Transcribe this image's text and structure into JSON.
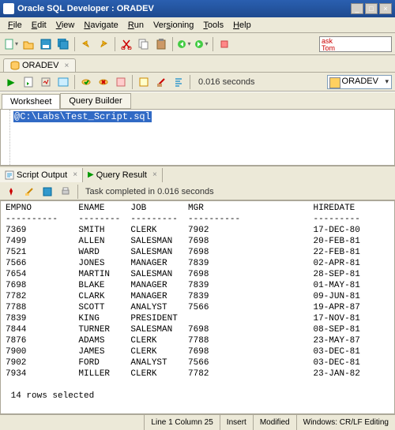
{
  "window": {
    "title": "Oracle SQL Developer : ORADEV"
  },
  "menu": {
    "file": "File",
    "edit": "Edit",
    "view": "View",
    "navigate": "Navigate",
    "run": "Run",
    "versioning": "Versioning",
    "tools": "Tools",
    "help": "Help"
  },
  "ask": {
    "line1": "ask",
    "line2": "Tom"
  },
  "connTab": {
    "label": "ORADEV"
  },
  "sqlTiming": "0.016 seconds",
  "connSelect": "ORADEV",
  "worksheet": {
    "tab1": "Worksheet",
    "tab2": "Query Builder"
  },
  "editorText": "@C:\\Labs\\Test_Script.sql",
  "outputTabs": {
    "script": "Script Output",
    "query": "Query Result"
  },
  "taskStatus": "Task completed in 0.016 seconds",
  "columns": [
    "EMPNO",
    "ENAME",
    "JOB",
    "MGR",
    "HIREDATE"
  ],
  "rows": [
    [
      "7369",
      "SMITH",
      "CLERK",
      "7902",
      "17-DEC-80"
    ],
    [
      "7499",
      "ALLEN",
      "SALESMAN",
      "7698",
      "20-FEB-81"
    ],
    [
      "7521",
      "WARD",
      "SALESMAN",
      "7698",
      "22-FEB-81"
    ],
    [
      "7566",
      "JONES",
      "MANAGER",
      "7839",
      "02-APR-81"
    ],
    [
      "7654",
      "MARTIN",
      "SALESMAN",
      "7698",
      "28-SEP-81"
    ],
    [
      "7698",
      "BLAKE",
      "MANAGER",
      "7839",
      "01-MAY-81"
    ],
    [
      "7782",
      "CLARK",
      "MANAGER",
      "7839",
      "09-JUN-81"
    ],
    [
      "7788",
      "SCOTT",
      "ANALYST",
      "7566",
      "19-APR-87"
    ],
    [
      "7839",
      "KING",
      "PRESIDENT",
      "",
      "17-NOV-81"
    ],
    [
      "7844",
      "TURNER",
      "SALESMAN",
      "7698",
      "08-SEP-81"
    ],
    [
      "7876",
      "ADAMS",
      "CLERK",
      "7788",
      "23-MAY-87"
    ],
    [
      "7900",
      "JAMES",
      "CLERK",
      "7698",
      "03-DEC-81"
    ],
    [
      "7902",
      "FORD",
      "ANALYST",
      "7566",
      "03-DEC-81"
    ],
    [
      "7934",
      "MILLER",
      "CLERK",
      "7782",
      "23-JAN-82"
    ]
  ],
  "rowsSelected": " 14 rows selected",
  "statusbar": {
    "pos": "Line 1 Column 25",
    "mode": "Insert",
    "mod": "Modified",
    "enc": "Windows: CR/LF Editing"
  }
}
